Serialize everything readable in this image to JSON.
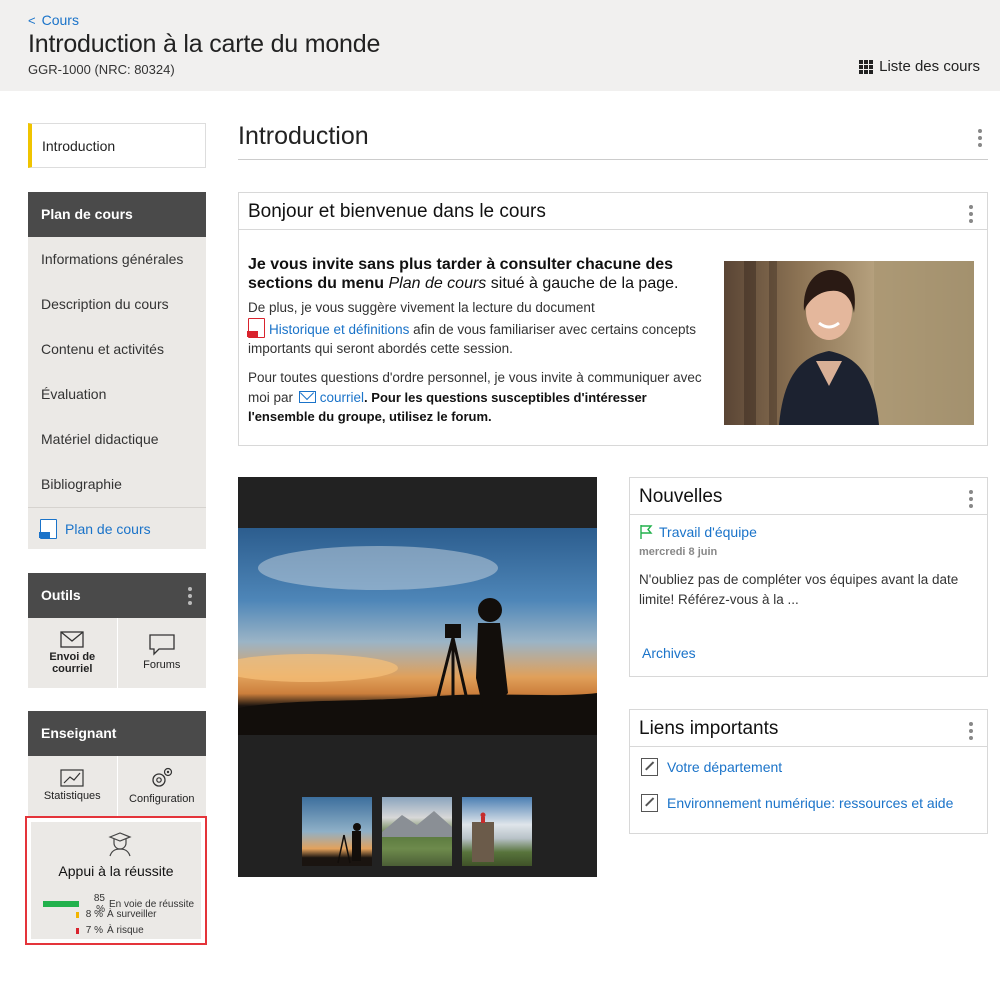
{
  "header": {
    "back_label": "Cours",
    "title": "Introduction à la carte du monde",
    "code": "GGR-1000 (NRC: 80324)",
    "courses_list_label": "Liste des cours"
  },
  "sidebar": {
    "intro_label": "Introduction",
    "plan_header": "Plan de cours",
    "plan_items": [
      "Informations générales",
      "Description du cours",
      "Contenu et activités",
      "Évaluation",
      "Matériel didactique",
      "Bibliographie"
    ],
    "plan_pdf_label": "Plan de cours",
    "tools_header": "Outils",
    "tools": [
      "Envoi de courriel",
      "Forums"
    ],
    "teacher_header": "Enseignant",
    "teacher_tools": [
      "Statistiques",
      "Configuration"
    ],
    "success": {
      "title": "Appui à la réussite",
      "rows": [
        {
          "pct": "85 %",
          "label": "En voie de réussite",
          "color": "#22b14c"
        },
        {
          "pct": "8 %",
          "label": "À surveiller",
          "color": "#f2b400"
        },
        {
          "pct": "7 %",
          "label": "À risque",
          "color": "#d9232d"
        }
      ]
    }
  },
  "main": {
    "title": "Introduction",
    "welcome": {
      "heading": "Bonjour et bienvenue dans le cours",
      "lead_a": "Je vous invite sans plus tarder à consulter chacune des sections du menu ",
      "lead_em": "Plan de cours",
      "lead_b": " situé à gauche de la page.",
      "p1_a": "De plus, je vous suggère vivement la lecture du document",
      "p1_link": "Historique et définitions",
      "p1_b": " afin de vous familiariser avec certains concepts importants qui seront abordés cette session.",
      "p2_a": "Pour toutes questions d'ordre personnel, je vous invite à communiquer avec moi par",
      "p2_link": "courriel",
      "p2_b": ". Pour les questions susceptibles d'intéresser l'ensemble du groupe, utilisez le forum."
    },
    "news": {
      "heading": "Nouvelles",
      "item_title": "Travail d'équipe",
      "item_date": "mercredi 8 juin",
      "item_body": "N'oubliez pas de compléter vos équipes avant la date limite! Référez-vous à la ...",
      "archives_label": "Archives"
    },
    "links": {
      "heading": "Liens importants",
      "items": [
        "Votre département",
        "Environnement numérique: ressources et aide"
      ]
    }
  }
}
